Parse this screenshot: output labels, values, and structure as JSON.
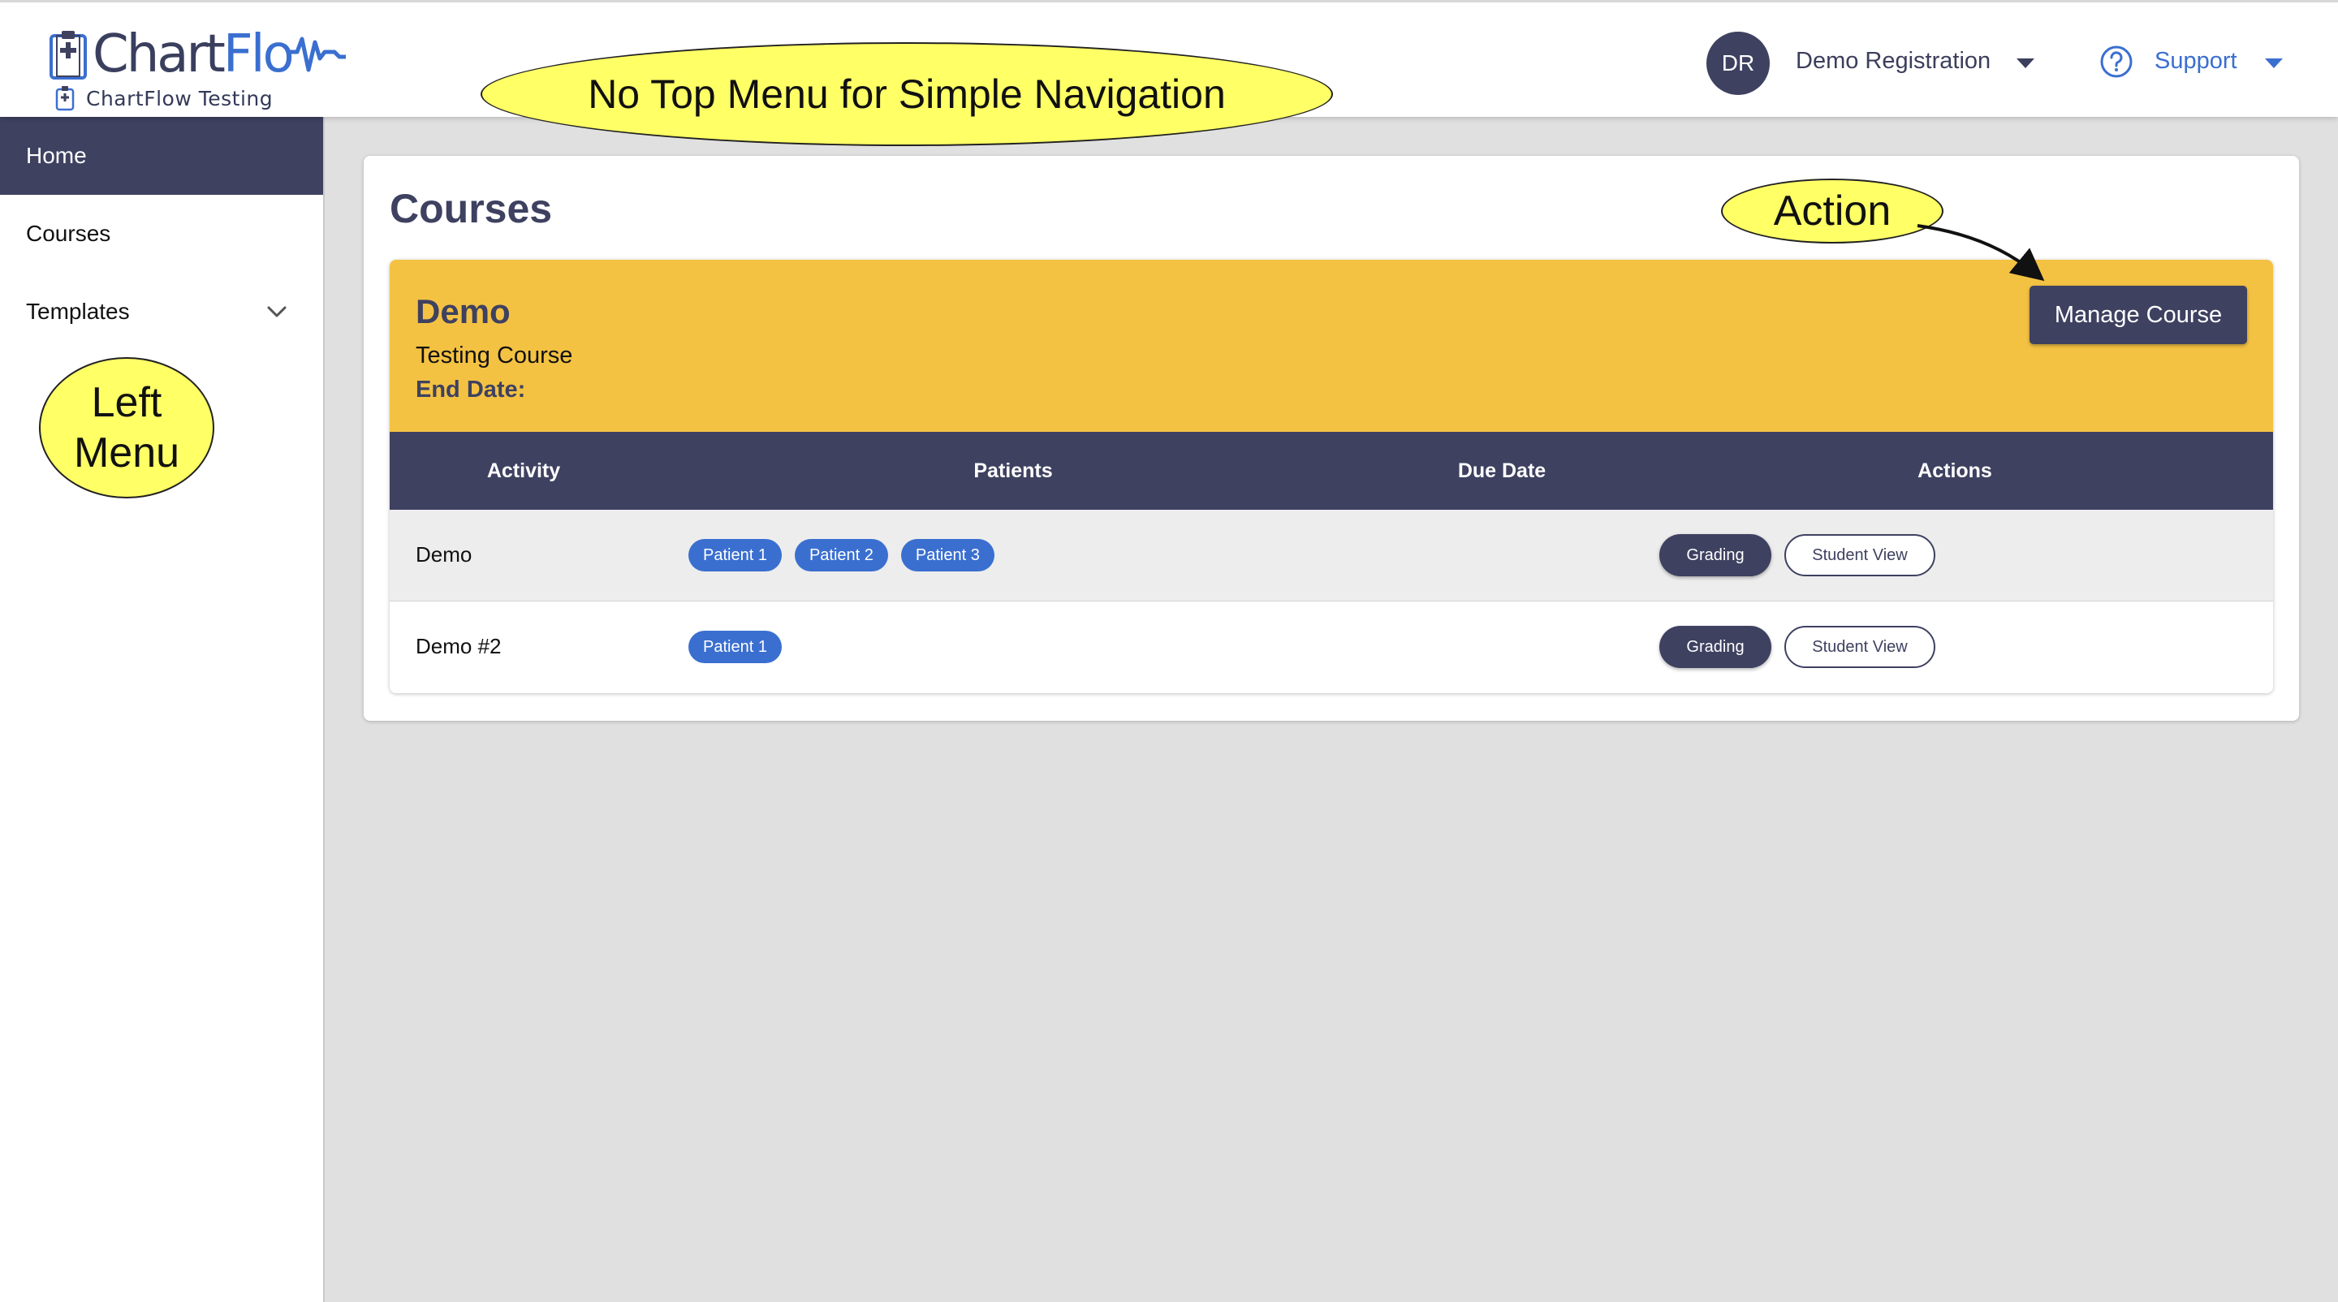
{
  "header": {
    "logo_text_part1": "Chart",
    "logo_text_part2": "Flo",
    "logo_subtitle": "ChartFlow Testing",
    "user_initials": "DR",
    "user_name": "Demo Registration",
    "support_label": "Support",
    "icons": [
      "clipboard-icon",
      "heartbeat-wave-icon",
      "caret-down-icon",
      "help-circle-icon"
    ]
  },
  "sidebar": {
    "items": [
      {
        "label": "Home",
        "active": true
      },
      {
        "label": "Courses",
        "active": false
      },
      {
        "label": "Templates",
        "active": false,
        "expandable": true
      }
    ]
  },
  "main": {
    "page_title": "Courses",
    "course": {
      "name": "Demo",
      "description": "Testing Course",
      "end_date_label": "End Date:",
      "manage_label": "Manage Course",
      "columns": [
        "Activity",
        "Patients",
        "Due Date",
        "Actions"
      ],
      "rows": [
        {
          "activity": "Demo",
          "patients": [
            "Patient 1",
            "Patient 2",
            "Patient 3"
          ],
          "due_date": "",
          "actions": [
            "Grading",
            "Student View"
          ]
        },
        {
          "activity": "Demo #2",
          "patients": [
            "Patient 1"
          ],
          "due_date": "",
          "actions": [
            "Grading",
            "Student View"
          ]
        }
      ]
    }
  },
  "annotations": {
    "top": "No Top Menu for Simple Navigation",
    "action": "Action",
    "left": "Left\nMenu"
  },
  "colors": {
    "navy": "#3e4160",
    "blue": "#3a6fd0",
    "course_header": "#f4c243",
    "annotation": "#ffff66",
    "background": "#e0e0e0"
  }
}
